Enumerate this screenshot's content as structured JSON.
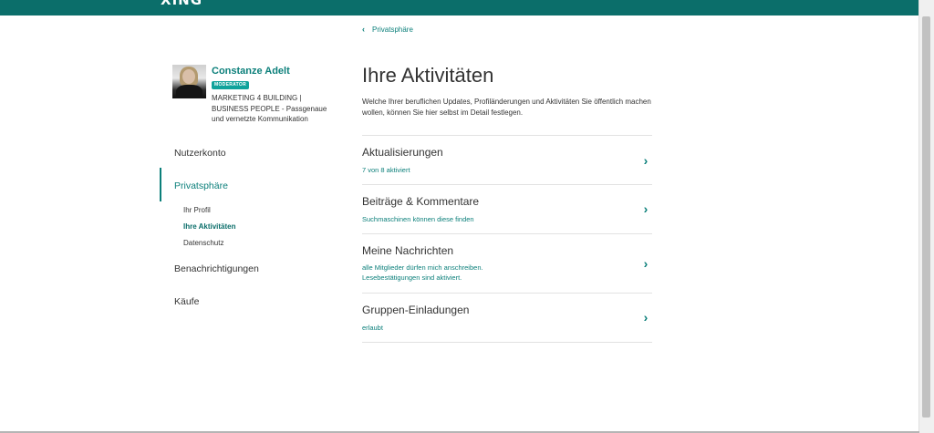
{
  "header": {
    "logo_text": "XING",
    "brand_color": "#0b6e6a"
  },
  "profile": {
    "name": "Constanze Adelt",
    "badge": "MODERATOR",
    "description": "MARKETING 4 BUILDING | BUSINESS PEOPLE - Passgenaue und vernetzte Kommunikation"
  },
  "sidebar": {
    "items": [
      {
        "label": "Nutzerkonto"
      },
      {
        "label": "Privatsphäre",
        "active": true
      },
      {
        "label": "Benachrichtigungen"
      },
      {
        "label": "Käufe"
      }
    ],
    "subitems": [
      {
        "label": "Ihr Profil"
      },
      {
        "label": "Ihre Aktivitäten",
        "active": true
      },
      {
        "label": "Datenschutz"
      }
    ]
  },
  "main": {
    "breadcrumb": "Privatsphäre",
    "title": "Ihre Aktivitäten",
    "intro": "Welche Ihrer beruflichen Updates, Profiländerungen und Aktivitäten Sie öffentlich machen wollen, können Sie hier selbst im Detail festlegen.",
    "rows": [
      {
        "title": "Aktualisierungen",
        "subtitle": "7 von 8 aktiviert"
      },
      {
        "title": "Beiträge & Kommentare",
        "subtitle": "Suchmaschinen können diese finden"
      },
      {
        "title": "Meine Nachrichten",
        "subtitle": "alle Mitglieder dürfen mich anschreiben. Lesebestätigungen sind aktiviert."
      },
      {
        "title": "Gruppen-Einladungen",
        "subtitle": "erlaubt"
      }
    ]
  }
}
